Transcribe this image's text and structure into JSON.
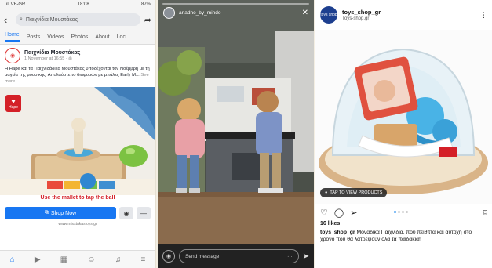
{
  "facebook": {
    "status": {
      "carrier": "ull VF-GR",
      "time": "18:08",
      "battery": "87%"
    },
    "search": {
      "query": "Παιχνίδια Μουστάκας"
    },
    "tabs": [
      "Home",
      "Posts",
      "Videos",
      "Photos",
      "About",
      "Loc"
    ],
    "post": {
      "page_name": "Παιχνίδια Μουστάκας",
      "meta": "1 November at 16:55 · ",
      "text": "Η Hape και τα Παιχνιδάδικα Μουστάκας υποδέχονται τον Νοέμβρη με τη μαγεία της μουσικής! Απολαύστε το διάφορων με μπάλες Early M...",
      "see_more": "See more",
      "logo_label": "Hape",
      "banner_text": "Use the mallet to tap the ball",
      "shop_button": "Shop Now",
      "url": "www.mixstakastoys.gr"
    },
    "nav_icons": [
      "home-icon",
      "video-icon",
      "marketplace-icon",
      "groups-icon",
      "bell-icon",
      "menu-icon"
    ]
  },
  "story": {
    "username": "ariadne_by_mindo",
    "reply_placeholder": "Send message"
  },
  "instagram": {
    "username": "toys_shop_gr",
    "subtitle": "Toys-shop.gr",
    "avatar_text": "toys shop",
    "tap_label": "TAP TO VIEW PRODUCTS",
    "likes": "16 likes",
    "caption_user": "toys_shop_gr",
    "caption": "Μοναδικά Παιχνίδια, που πειθ'ττα και αυτοχή στο χρόνο που θα λατρέψουν όλα τα παιδάκια!"
  }
}
